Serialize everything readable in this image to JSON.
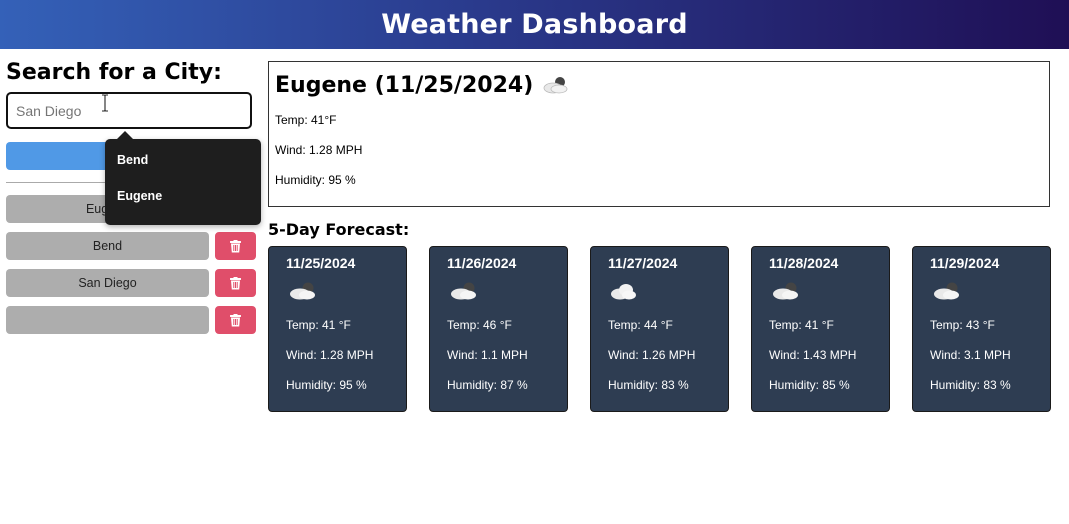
{
  "header": {
    "title": "Weather Dashboard"
  },
  "sidebar": {
    "heading": "Search for a City:",
    "search_placeholder": "San Diego",
    "history": [
      {
        "label": "Eugene"
      },
      {
        "label": "Bend"
      },
      {
        "label": "San Diego"
      },
      {
        "label": ""
      }
    ]
  },
  "suggestions": [
    "Bend",
    "Eugene"
  ],
  "current": {
    "title": "Eugene (11/25/2024)",
    "icon": "cloud-sun-icon",
    "temp": "Temp: 41°F",
    "wind": "Wind: 1.28 MPH",
    "humidity": "Humidity: 95 %"
  },
  "forecast": {
    "title": "5-Day Forecast:",
    "days": [
      {
        "date": "11/25/2024",
        "icon": "partly-cloudy-icon",
        "temp": "Temp: 41 °F",
        "wind": "Wind: 1.28 MPH",
        "humidity": "Humidity: 95 %"
      },
      {
        "date": "11/26/2024",
        "icon": "partly-cloudy-icon",
        "temp": "Temp: 46 °F",
        "wind": "Wind: 1.1 MPH",
        "humidity": "Humidity: 87 %"
      },
      {
        "date": "11/27/2024",
        "icon": "cloud-icon",
        "temp": "Temp: 44 °F",
        "wind": "Wind: 1.26 MPH",
        "humidity": "Humidity: 83 %"
      },
      {
        "date": "11/28/2024",
        "icon": "partly-cloudy-icon",
        "temp": "Temp: 41 °F",
        "wind": "Wind: 1.43 MPH",
        "humidity": "Humidity: 85 %"
      },
      {
        "date": "11/29/2024",
        "icon": "partly-cloudy-icon",
        "temp": "Temp: 43 °F",
        "wind": "Wind: 3.1 MPH",
        "humidity": "Humidity: 83 %"
      }
    ]
  },
  "colors": {
    "header_start": "#3461b8",
    "header_end": "#1f0f55",
    "search_button": "#5099e6",
    "delete_button": "#e04e6a",
    "history_button": "#adadad",
    "card_bg": "#2e3d52"
  }
}
